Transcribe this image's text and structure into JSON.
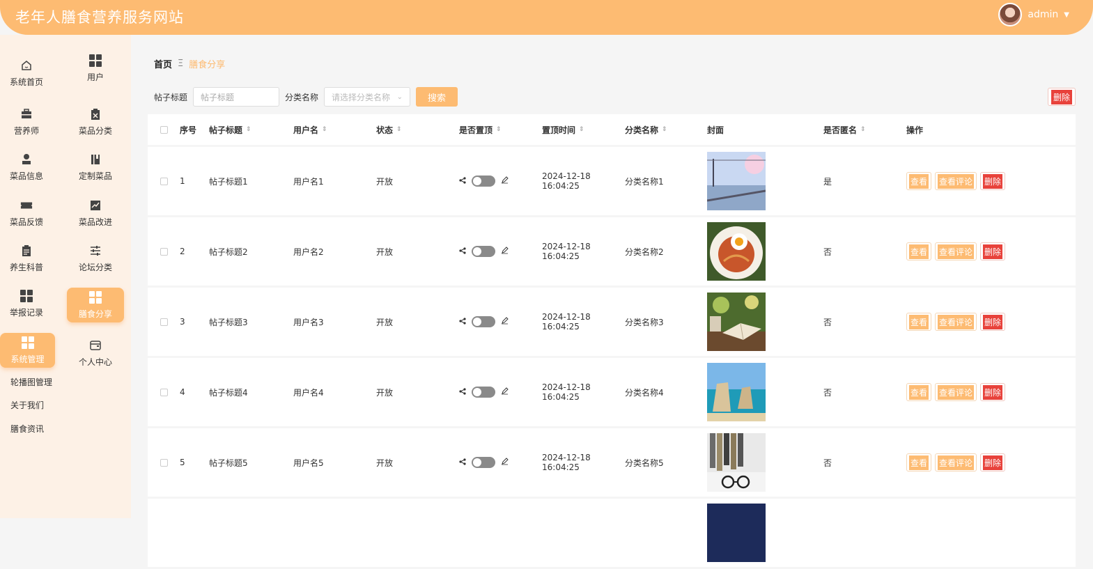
{
  "header": {
    "title": "老年人膳食营养服务网站",
    "username": "admin"
  },
  "sidebar": {
    "items": [
      {
        "label": "系统首页",
        "icon": "home-icon"
      },
      {
        "label": "用户",
        "icon": "grid-icon"
      },
      {
        "label": "营养师",
        "icon": "briefcase-icon"
      },
      {
        "label": "菜品分类",
        "icon": "clipboard-icon"
      },
      {
        "label": "菜品信息",
        "icon": "person-icon"
      },
      {
        "label": "定制菜品",
        "icon": "book-icon"
      },
      {
        "label": "菜品反馈",
        "icon": "ticket-icon"
      },
      {
        "label": "菜品改进",
        "icon": "chart-icon"
      },
      {
        "label": "养生科普",
        "icon": "notepad-icon"
      },
      {
        "label": "论坛分类",
        "icon": "sliders-icon"
      },
      {
        "label": "举报记录",
        "icon": "grid-icon"
      },
      {
        "label": "膳食分享",
        "icon": "grid-icon"
      },
      {
        "label": "系统管理",
        "icon": "grid-icon"
      },
      {
        "label": "个人中心",
        "icon": "wallet-icon"
      }
    ],
    "submenu": [
      "轮播图管理",
      "关于我们",
      "膳食资讯"
    ]
  },
  "breadcrumb": {
    "home": "首页",
    "separator": "Ξ",
    "current": "膳食分享"
  },
  "search": {
    "title_label": "帖子标题",
    "title_placeholder": "帖子标题",
    "category_label": "分类名称",
    "category_placeholder": "请选择分类名称",
    "search_button": "搜索",
    "delete_button": "删除"
  },
  "table": {
    "headers": [
      "序号",
      "帖子标题",
      "用户名",
      "状态",
      "是否置顶",
      "置顶时间",
      "分类名称",
      "封面",
      "是否匿名",
      "操作"
    ],
    "rows": [
      {
        "index": "1",
        "title": "帖子标题1",
        "user": "用户名1",
        "status": "开放",
        "time": "2024-12-18 16:04:25",
        "category": "分类名称1",
        "anonymous": "是",
        "cover": "train-scene"
      },
      {
        "index": "2",
        "title": "帖子标题2",
        "user": "用户名2",
        "status": "开放",
        "time": "2024-12-18 16:04:25",
        "category": "分类名称2",
        "anonymous": "否",
        "cover": "pasta-dish"
      },
      {
        "index": "3",
        "title": "帖子标题3",
        "user": "用户名3",
        "status": "开放",
        "time": "2024-12-18 16:04:25",
        "category": "分类名称3",
        "anonymous": "否",
        "cover": "book-and-cup"
      },
      {
        "index": "4",
        "title": "帖子标题4",
        "user": "用户名4",
        "status": "开放",
        "time": "2024-12-18 16:04:25",
        "category": "分类名称4",
        "anonymous": "否",
        "cover": "sea-rocks"
      },
      {
        "index": "5",
        "title": "帖子标题5",
        "user": "用户名5",
        "status": "开放",
        "time": "2024-12-18 16:04:25",
        "category": "分类名称5",
        "anonymous": "否",
        "cover": "books-and-glasses"
      }
    ],
    "actions": {
      "view": "查看",
      "comments": "查看评论",
      "delete": "删除"
    }
  },
  "colors": {
    "accent": "#fdbb72",
    "danger": "#e8423b",
    "sidebar_bg": "#fdf1e6"
  }
}
